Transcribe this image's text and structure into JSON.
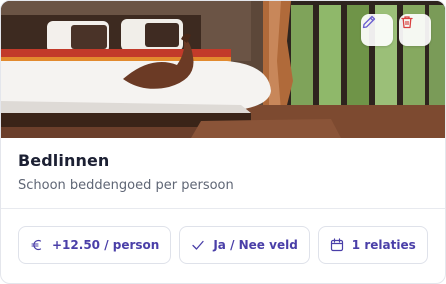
{
  "card": {
    "title": "Bedlinnen",
    "description": "Schoon beddengoed per persoon",
    "image_alt": "bedroom photo",
    "actions": {
      "edit_icon": "pencil-icon",
      "delete_icon": "trash-icon"
    },
    "chips": [
      {
        "icon": "euro-icon",
        "label": "+12.50 / person"
      },
      {
        "icon": "check-icon",
        "label": "Ja / Nee veld"
      },
      {
        "icon": "calendar-icon",
        "label": "1 relaties"
      }
    ]
  },
  "colors": {
    "accent": "#4a3fa8",
    "delete": "#d94040",
    "edit": "#6a5fd0",
    "title": "#1c2033",
    "muted": "#5f6675",
    "border": "#dfe2ea"
  }
}
